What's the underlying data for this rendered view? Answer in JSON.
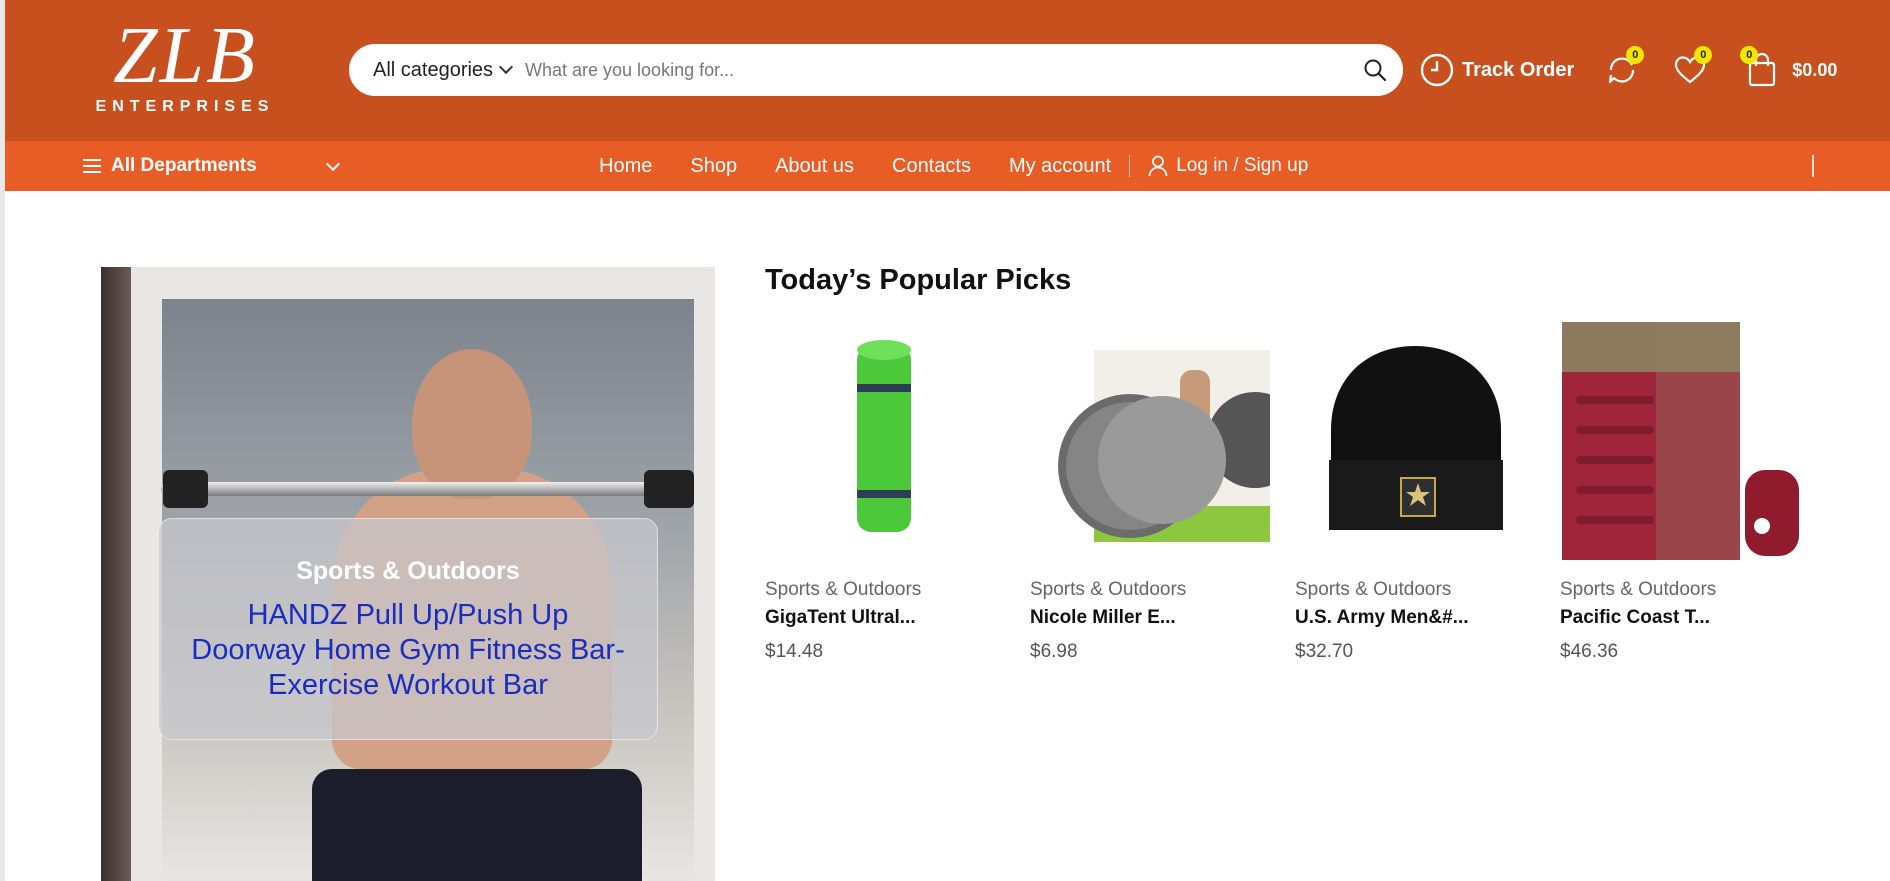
{
  "header": {
    "logo_mark": "ZLB",
    "logo_sub": "ENTERPRISES",
    "search": {
      "category_label": "All categories",
      "placeholder": "What are you looking for..."
    },
    "track_order": "Track Order",
    "compare_count": "0",
    "wishlist_count": "0",
    "cart_count": "0",
    "cart_total": "$0.00"
  },
  "nav": {
    "departments_label": "All Departments",
    "links": [
      "Home",
      "Shop",
      "About us",
      "Contacts",
      "My account"
    ],
    "login_label": "Log in / Sign up"
  },
  "hero": {
    "category": "Sports & Outdoors",
    "title": "HANDZ Pull Up/Push Up Doorway Home Gym Fitness Bar- Exercise Workout Bar"
  },
  "picks": {
    "title": "Today’s Popular Picks",
    "products": [
      {
        "category": "Sports & Outdoors",
        "name": "GigaTent Ultral...",
        "price": "$14.48"
      },
      {
        "category": "Sports & Outdoors",
        "name": "Nicole Miller E...",
        "price": "$6.98"
      },
      {
        "category": "Sports & Outdoors",
        "name": "U.S. Army Men&#...",
        "price": "$32.70"
      },
      {
        "category": "Sports & Outdoors",
        "name": "Pacific Coast T...",
        "price": "$46.36"
      }
    ]
  },
  "colors": {
    "header_bg": "#c8501f",
    "nav_bg": "#e85d26",
    "badge": "#f3e600",
    "hero_link": "#1a2dbf"
  }
}
